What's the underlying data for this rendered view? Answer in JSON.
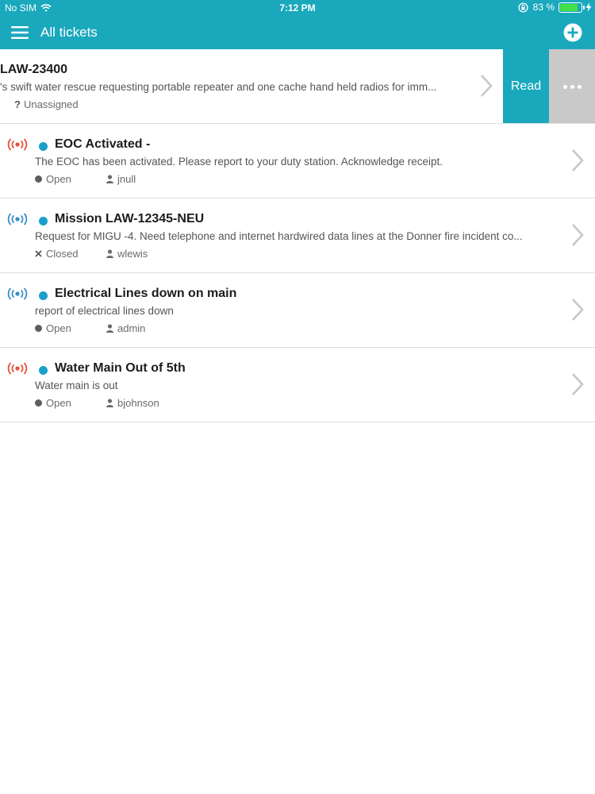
{
  "status_bar": {
    "carrier": "No SIM",
    "time": "7:12 PM",
    "battery_text": "83 %",
    "battery_level": 0.83
  },
  "nav": {
    "title": "All tickets",
    "menu_icon": "hamburger-icon",
    "add_icon": "plus-circle-icon"
  },
  "colors": {
    "accent": "#1aa8bd",
    "unread_dot": "#1a9fcb",
    "signal_red": "#e0533d",
    "signal_blue": "#3a8fc7"
  },
  "tickets": [
    {
      "title": "LAW-23400",
      "description": "'s swift water rescue requesting portable repeater and one cache hand held radios for imm...",
      "status": "",
      "assignee": "Unassigned",
      "swiped": true,
      "actions": {
        "read_label": "Read",
        "more_label": "•••"
      }
    },
    {
      "title": "EOC Activated -",
      "description": "The EOC has been activated. Please report to your duty station. Acknowledge receipt.",
      "status": "Open",
      "assignee": "jnull",
      "signal": "red",
      "unread": true
    },
    {
      "title": "Mission LAW-12345-NEU",
      "description": "Request for MIGU -4. Need telephone and internet hardwired data lines at the Donner fire incident co...",
      "status": "Closed",
      "assignee": "wlewis",
      "signal": "blue",
      "unread": true
    },
    {
      "title": "Electrical Lines down on main",
      "description": "report of electrical lines down",
      "status": "Open",
      "assignee": "admin",
      "signal": "blue",
      "unread": true
    },
    {
      "title": "Water Main Out of 5th",
      "description": "Water main is out",
      "status": "Open",
      "assignee": "bjohnson",
      "signal": "red",
      "unread": true
    }
  ]
}
